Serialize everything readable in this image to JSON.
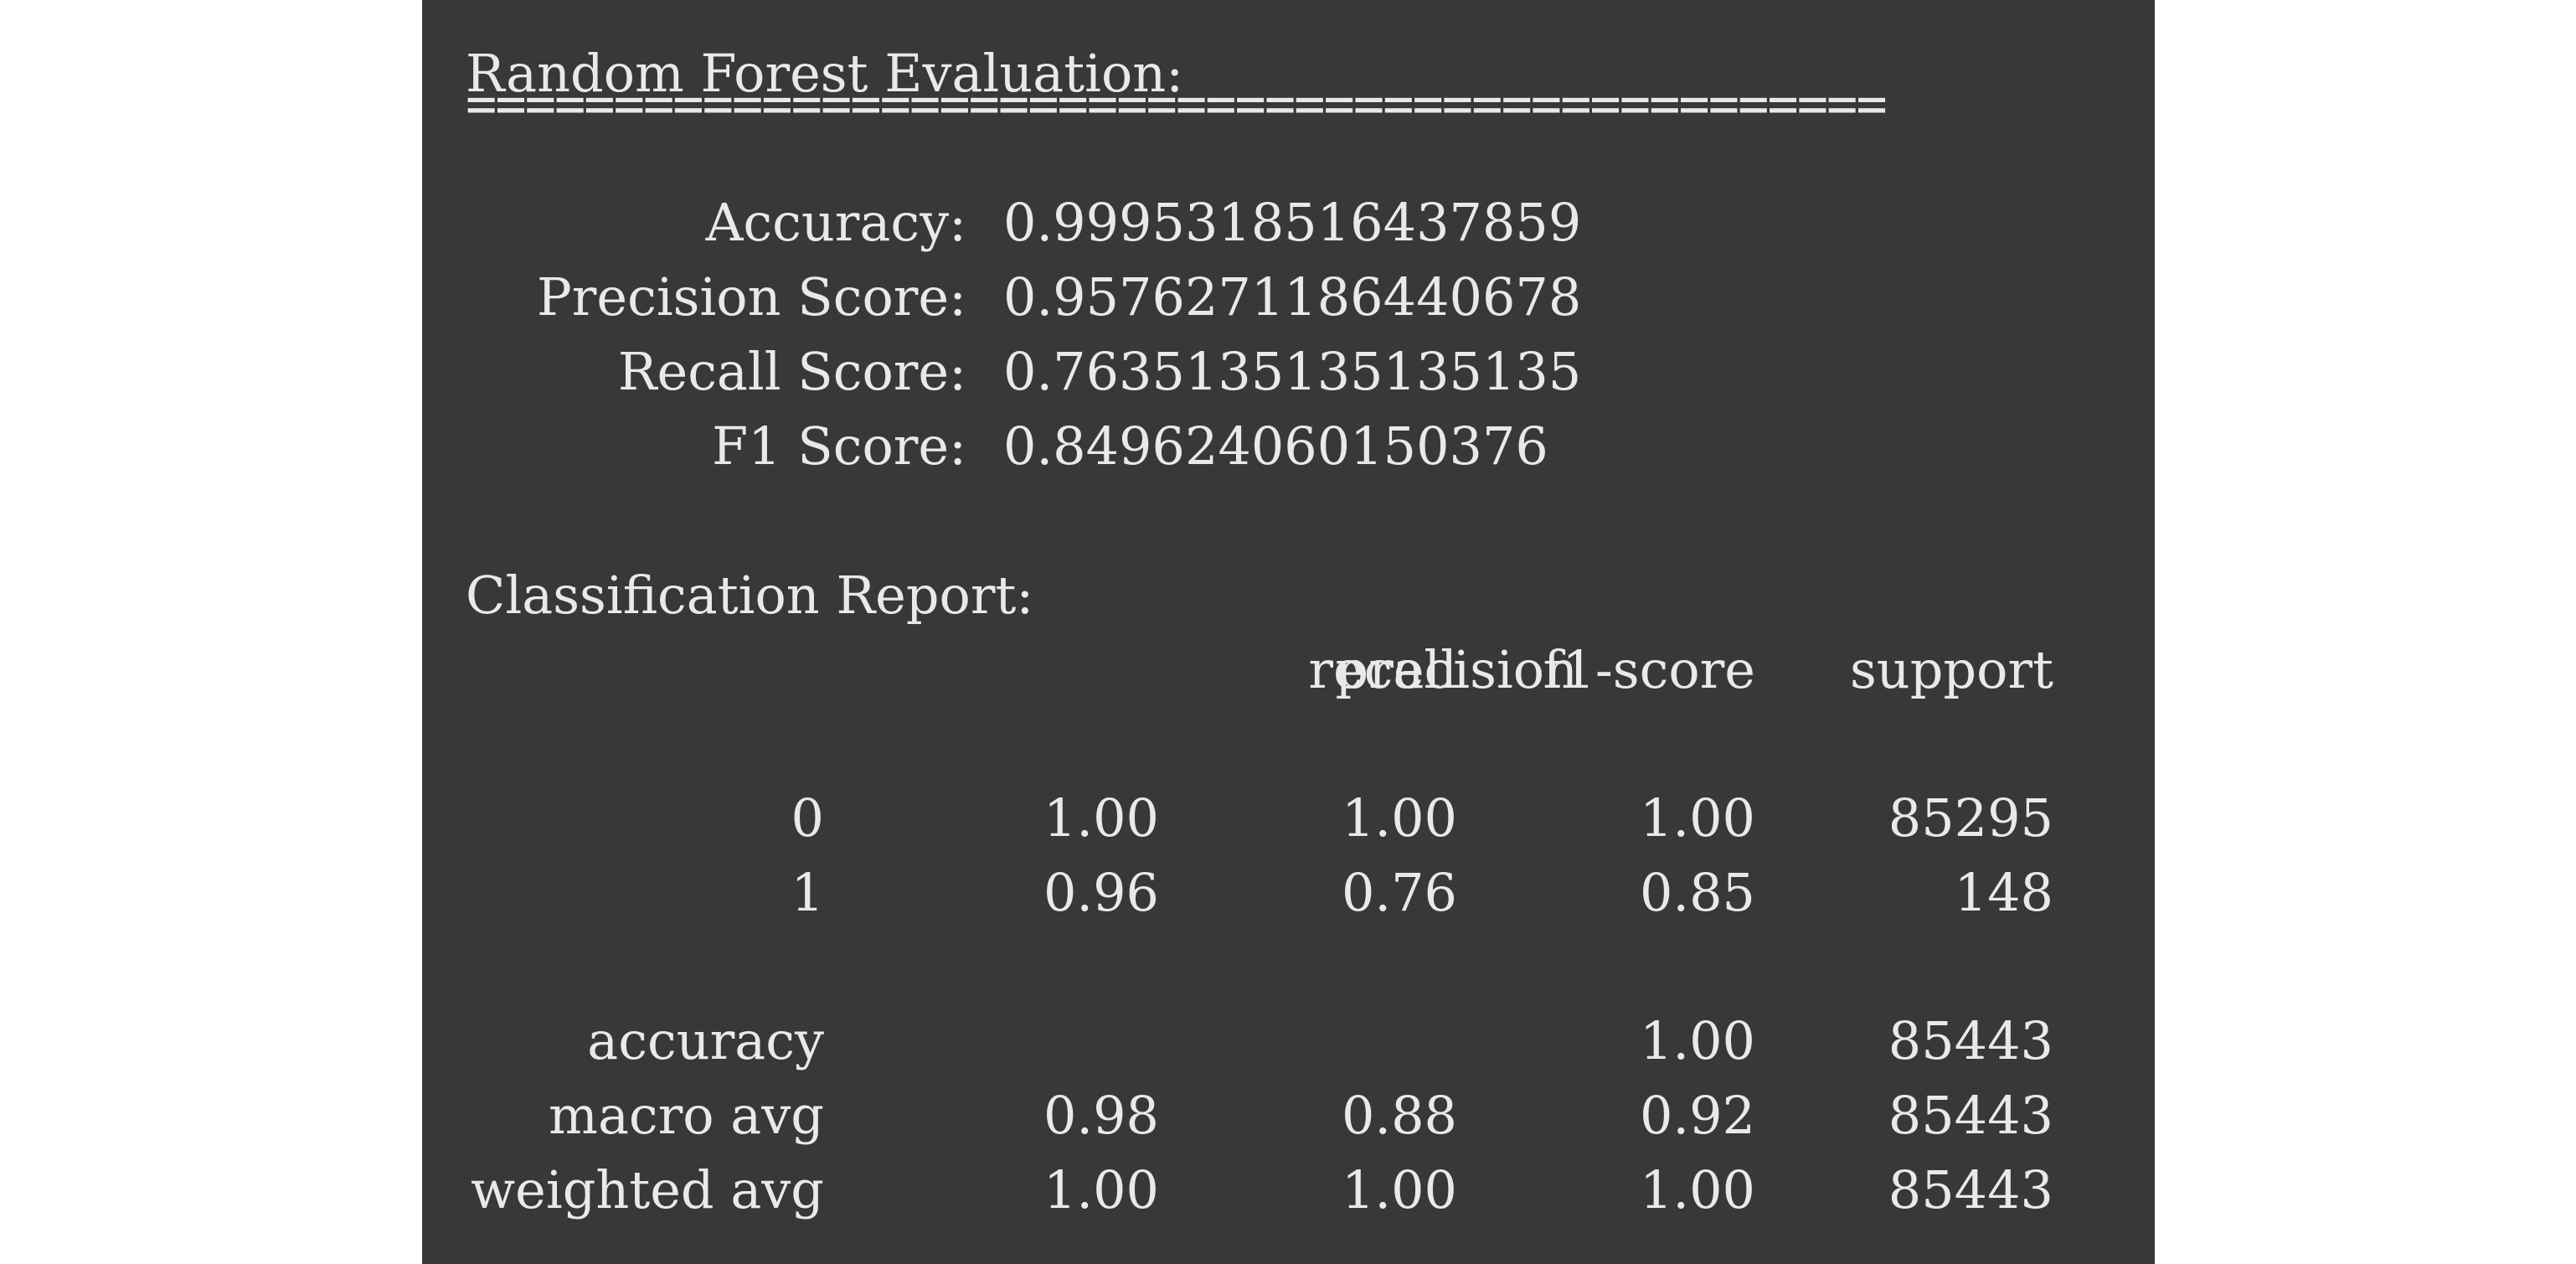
{
  "title": "Random Forest Evaluation:",
  "separator": "================================================",
  "metrics": [
    {
      "label": "Accuracy:",
      "value": "0.9995318516437859"
    },
    {
      "label": "Precision Score:",
      "value": "0.9576271186440678"
    },
    {
      "label": "Recall Score:",
      "value": "0.7635135135135135"
    },
    {
      "label": "F1 Score:",
      "value": "0.849624060150376"
    }
  ],
  "report": {
    "heading": "Classification Report:",
    "columns": [
      "precision",
      "recall",
      "f1-score",
      "support"
    ],
    "class_rows": [
      {
        "label": "0",
        "precision": "1.00",
        "recall": "1.00",
        "f1": "1.00",
        "support": "85295"
      },
      {
        "label": "1",
        "precision": "0.96",
        "recall": "0.76",
        "f1": "0.85",
        "support": "148"
      }
    ],
    "summary_rows": [
      {
        "label": "accuracy",
        "precision": "",
        "recall": "",
        "f1": "1.00",
        "support": "85443"
      },
      {
        "label": "macro avg",
        "precision": "0.98",
        "recall": "0.88",
        "f1": "0.92",
        "support": "85443"
      },
      {
        "label": "weighted avg",
        "precision": "1.00",
        "recall": "1.00",
        "f1": "1.00",
        "support": "85443"
      }
    ]
  }
}
